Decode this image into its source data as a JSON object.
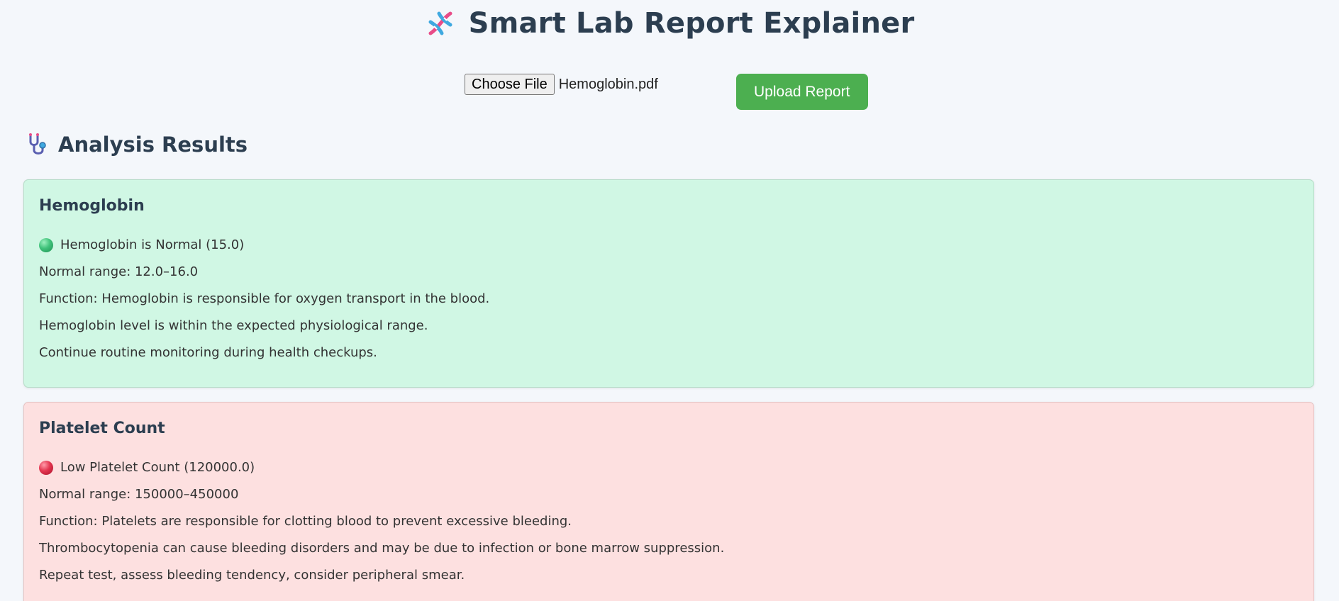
{
  "header": {
    "title": "Smart Lab Report Explainer",
    "icon": "dna-icon"
  },
  "upload": {
    "choose_file_label": "Choose File",
    "file_name": "Hemoglobin.pdf",
    "upload_button_label": "Upload Report",
    "upload_button_color": "#4caf50"
  },
  "results": {
    "heading": "Analysis Results",
    "icon": "stethoscope-icon",
    "cards": [
      {
        "title": "Hemoglobin",
        "status": "normal",
        "status_color": "#d0f7e4",
        "status_icon": "green-circle-icon",
        "status_text": "Hemoglobin is Normal (15.0)",
        "range": "Normal range: 12.0–16.0",
        "function": "Function: Hemoglobin is responsible for oxygen transport in the blood.",
        "explanation": "Hemoglobin level is within the expected physiological range.",
        "recommendation": "Continue routine monitoring during health checkups."
      },
      {
        "title": "Platelet Count",
        "status": "low",
        "status_color": "#fde0e0",
        "status_icon": "red-circle-icon",
        "status_text": "Low Platelet Count (120000.0)",
        "range": "Normal range: 150000–450000",
        "function": "Function: Platelets are responsible for clotting blood to prevent excessive bleeding.",
        "explanation": "Thrombocytopenia can cause bleeding disorders and may be due to infection or bone marrow suppression.",
        "recommendation": "Repeat test, assess bleeding tendency, consider peripheral smear."
      }
    ]
  }
}
